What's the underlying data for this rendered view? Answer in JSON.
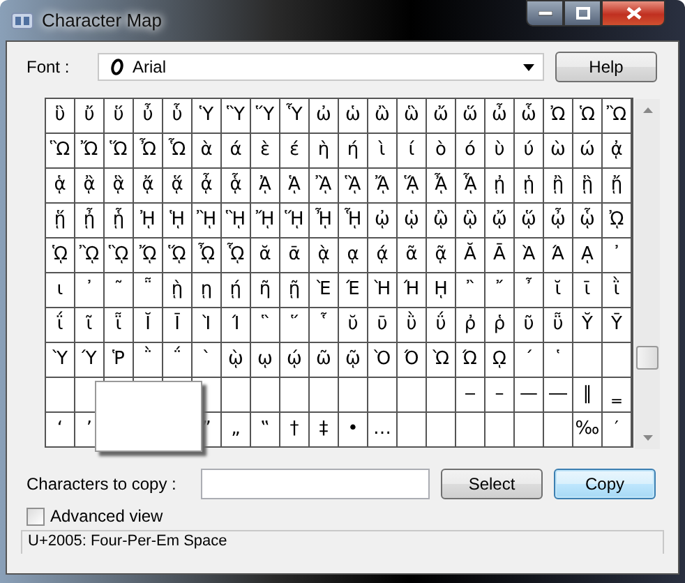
{
  "window": {
    "title": "Character Map"
  },
  "font": {
    "label": "Font :",
    "value": "Arial"
  },
  "help_button": "Help",
  "grid": {
    "rows": [
      [
        "ὓ",
        "ὔ",
        "ὕ",
        "ὖ",
        "ὗ",
        "Ὑ",
        "Ὓ",
        "Ὕ",
        "Ὗ",
        "ὠ",
        "ὡ",
        "ὢ",
        "ὣ",
        "ὤ",
        "ὥ",
        "ὦ",
        "ὧ",
        "Ὠ",
        "Ὡ",
        "Ὢ"
      ],
      [
        "Ὣ",
        "Ὤ",
        "Ὥ",
        "Ὦ",
        "Ὧ",
        "ὰ",
        "ά",
        "ὲ",
        "έ",
        "ὴ",
        "ή",
        "ὶ",
        "ί",
        "ὸ",
        "ό",
        "ὺ",
        "ύ",
        "ὼ",
        "ώ",
        "ᾀ"
      ],
      [
        "ᾁ",
        "ᾂ",
        "ᾃ",
        "ᾄ",
        "ᾅ",
        "ᾆ",
        "ᾇ",
        "ᾈ",
        "ᾉ",
        "ᾊ",
        "ᾋ",
        "ᾌ",
        "ᾍ",
        "ᾎ",
        "ᾏ",
        "ᾐ",
        "ᾑ",
        "ᾒ",
        "ᾓ",
        "ᾔ"
      ],
      [
        "ᾕ",
        "ᾖ",
        "ᾗ",
        "ᾘ",
        "ᾙ",
        "ᾚ",
        "ᾛ",
        "ᾜ",
        "ᾝ",
        "ᾞ",
        "ᾟ",
        "ᾠ",
        "ᾡ",
        "ᾢ",
        "ᾣ",
        "ᾤ",
        "ᾥ",
        "ᾦ",
        "ᾧ",
        "ᾨ"
      ],
      [
        "ᾩ",
        "ᾪ",
        "ᾫ",
        "ᾬ",
        "ᾭ",
        "ᾮ",
        "ᾯ",
        "ᾰ",
        "ᾱ",
        "ᾲ",
        "ᾳ",
        "ᾴ",
        "ᾶ",
        "ᾷ",
        "Ᾰ",
        "Ᾱ",
        "Ὰ",
        "Ά",
        "ᾼ",
        "᾽"
      ],
      [
        "ι",
        "᾿",
        "῀",
        "῁",
        "ῂ",
        "ῃ",
        "ῄ",
        "ῆ",
        "ῇ",
        "Ὲ",
        "Έ",
        "Ὴ",
        "Ή",
        "ῌ",
        "῍",
        "῎",
        "῏",
        "ῐ",
        "ῑ",
        "ῒ"
      ],
      [
        "ΐ",
        "ῖ",
        "ῗ",
        "Ῐ",
        "Ῑ",
        "Ὶ",
        "Ί",
        "῝",
        "῞",
        "῟",
        "ῠ",
        "ῡ",
        "ῢ",
        "ΰ",
        "ῤ",
        "ῥ",
        "ῦ",
        "ῧ",
        "Ῠ",
        "Ῡ"
      ],
      [
        "Ὺ",
        "Ύ",
        "Ῥ",
        "῭",
        "΅",
        "`",
        "ῲ",
        "ῳ",
        "ῴ",
        "ῶ",
        "ῷ",
        "Ὸ",
        "Ό",
        "Ὼ",
        "Ώ",
        "ῼ",
        "´",
        "῾",
        null,
        null
      ],
      [
        null,
        null,
        null,
        null,
        null,
        null,
        null,
        null,
        null,
        null,
        null,
        null,
        null,
        null,
        "‒",
        "–",
        "—",
        "―",
        "‖",
        "‗"
      ],
      [
        "‘",
        "’",
        null,
        null,
        null,
        "”",
        "„",
        "‟",
        "†",
        "‡",
        "•",
        "…",
        null,
        null,
        null,
        null,
        null,
        null,
        "‰",
        "′"
      ]
    ]
  },
  "copy_field": {
    "label": "Characters to copy :"
  },
  "select_button": {
    "label": "Select",
    "default": false
  },
  "copy_button": {
    "label": "Copy",
    "default": true
  },
  "advanced_view": {
    "label": "Advanced view",
    "checked": false
  },
  "status_bar": "U+2005: Four-Per-Em Space"
}
